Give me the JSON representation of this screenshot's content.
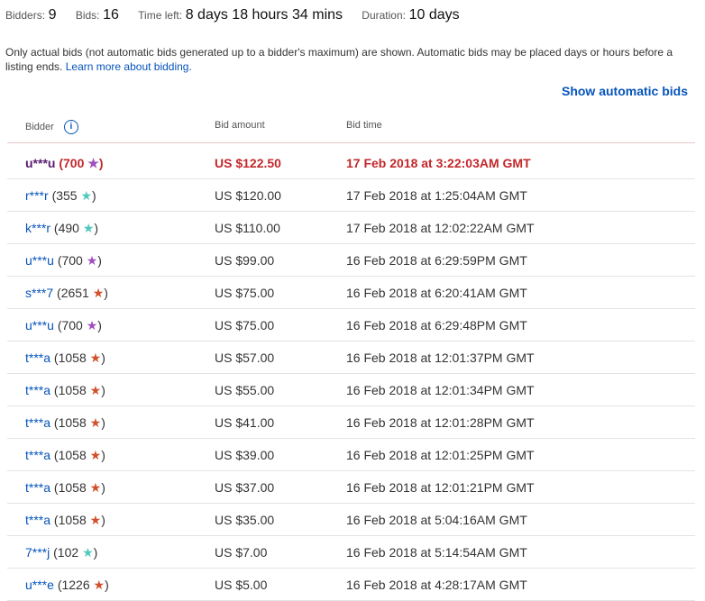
{
  "summary": {
    "bidders_label": "Bidders:",
    "bidders_value": "9",
    "bids_label": "Bids:",
    "bids_value": "16",
    "time_left_label": "Time left:",
    "time_left_value": "8 days 18 hours 34 mins",
    "duration_label": "Duration:",
    "duration_value": "10 days"
  },
  "note": {
    "text": "Only actual bids (not automatic bids generated up to a bidder's maximum) are shown. Automatic bids may be placed days or hours before a listing ends.",
    "link": "Learn more about bidding."
  },
  "show_automatic": "Show automatic bids",
  "headers": {
    "bidder": "Bidder",
    "info": "i",
    "amount": "Bid amount",
    "time": "Bid time"
  },
  "colors": {
    "turquoise": "#4fc9bd",
    "purple": "#a04fbf",
    "red": "#d2502a"
  },
  "bids": [
    {
      "bidder": "u***u",
      "fb_open": "(700",
      "star": "purple",
      "amount": "US $122.50",
      "time": "17 Feb 2018 at 3:22:03AM GMT",
      "winning": true
    },
    {
      "bidder": "r***r",
      "fb_open": "(355",
      "star": "turquoise",
      "amount": "US $120.00",
      "time": "17 Feb 2018 at 1:25:04AM GMT"
    },
    {
      "bidder": "k***r",
      "fb_open": "(490",
      "star": "turquoise",
      "amount": "US $110.00",
      "time": "17 Feb 2018 at 12:02:22AM GMT"
    },
    {
      "bidder": "u***u",
      "fb_open": "(700",
      "star": "purple",
      "amount": "US $99.00",
      "time": "16 Feb 2018 at 6:29:59PM GMT"
    },
    {
      "bidder": "s***7",
      "fb_open": "(2651",
      "star": "red",
      "amount": "US $75.00",
      "time": "16 Feb 2018 at 6:20:41AM GMT"
    },
    {
      "bidder": "u***u",
      "fb_open": "(700",
      "star": "purple",
      "amount": "US $75.00",
      "time": "16 Feb 2018 at 6:29:48PM GMT"
    },
    {
      "bidder": "t***a",
      "fb_open": "(1058",
      "star": "red",
      "amount": "US $57.00",
      "time": "16 Feb 2018 at 12:01:37PM GMT"
    },
    {
      "bidder": "t***a",
      "fb_open": "(1058",
      "star": "red",
      "amount": "US $55.00",
      "time": "16 Feb 2018 at 12:01:34PM GMT"
    },
    {
      "bidder": "t***a",
      "fb_open": "(1058",
      "star": "red",
      "amount": "US $41.00",
      "time": "16 Feb 2018 at 12:01:28PM GMT"
    },
    {
      "bidder": "t***a",
      "fb_open": "(1058",
      "star": "red",
      "amount": "US $39.00",
      "time": "16 Feb 2018 at 12:01:25PM GMT"
    },
    {
      "bidder": "t***a",
      "fb_open": "(1058",
      "star": "red",
      "amount": "US $37.00",
      "time": "16 Feb 2018 at 12:01:21PM GMT"
    },
    {
      "bidder": "t***a",
      "fb_open": "(1058",
      "star": "red",
      "amount": "US $35.00",
      "time": "16 Feb 2018 at 5:04:16AM GMT"
    },
    {
      "bidder": "7***j",
      "fb_open": "(102",
      "star": "turquoise",
      "amount": "US $7.00",
      "time": "16 Feb 2018 at 5:14:54AM GMT"
    },
    {
      "bidder": "u***e",
      "fb_open": "(1226",
      "star": "red",
      "amount": "US $5.00",
      "time": "16 Feb 2018 at 4:28:17AM GMT"
    }
  ]
}
